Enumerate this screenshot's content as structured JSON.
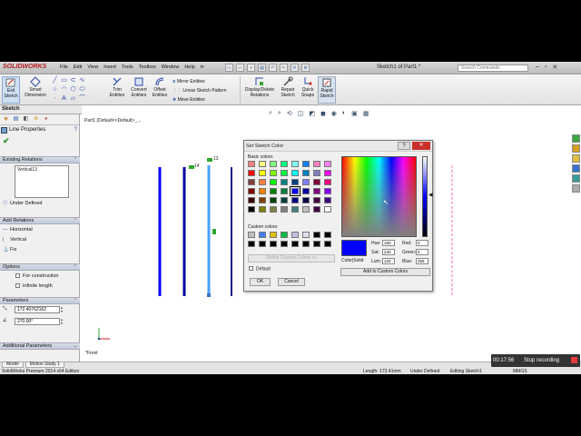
{
  "app": {
    "logo": "SOLIDWORKS",
    "menu": [
      "File",
      "Edit",
      "View",
      "Insert",
      "Tools",
      "Toolbox",
      "Window",
      "Help"
    ],
    "pin": "⊳",
    "document_title": "Sketch1 of Part1 *",
    "search_placeholder": "Search Commands",
    "win_min": "–",
    "win_restore": "▫",
    "win_close": "✕",
    "qat_icons": [
      "new-icon",
      "open-icon",
      "save-icon",
      "print-icon",
      "undo-icon",
      "select-icon",
      "rebuild-icon",
      "options-icon"
    ]
  },
  "command_manager": {
    "exit_sketch": "Exit Sketch",
    "smart_dimension": "Smart Dimension",
    "trim_entities": "Trim Entities",
    "convert_entities": "Convert Entities",
    "offset_entities": "Offset Entities",
    "mirror_entities": "Mirror Entities",
    "linear_sketch_pattern": "Linear Sketch Pattern",
    "move_entities": "Move Entities",
    "display_delete_relations": "Display/Delete Relations",
    "repair_sketch": "Repair Sketch",
    "quick_snaps": "Quick Snaps",
    "rapid_sketch": "Rapid Sketch",
    "tab_label": "Sketch"
  },
  "property_manager": {
    "title": "Line Properties",
    "help": "?",
    "ok": "✔",
    "existing_relations": {
      "header": "Existing Relations",
      "items": [
        "Vertical13"
      ],
      "status": "Under Defined"
    },
    "add_relations": {
      "header": "Add Relations",
      "items": [
        "Horizontal",
        "Vertical",
        "Fix"
      ]
    },
    "options": {
      "header": "Options",
      "for_construction": "For construction",
      "infinite_length": "Infinite length"
    },
    "parameters": {
      "header": "Parameters",
      "length": "172.40762162",
      "angle": "270.00°"
    },
    "additional_parameters": {
      "header": "Additional Parameters"
    }
  },
  "graphics": {
    "tree_label": "Part1  (Default<<Default>_...",
    "front_label": "*Front",
    "relation_tags": [
      "14",
      "13"
    ],
    "line_colors": [
      "#0000ff",
      "#0000a0",
      "#4aa0ff",
      "#1a1a8a"
    ]
  },
  "color_dialog": {
    "title": "Set Sketch Color",
    "help": "?",
    "close": "✕",
    "basic_colors_label": "Basic colors:",
    "custom_colors_label": "Custom colors:",
    "basic_colors": [
      "#ff8080",
      "#ffff80",
      "#80ff80",
      "#00ff80",
      "#80ffff",
      "#0080ff",
      "#ff80c0",
      "#ff80ff",
      "#ff0000",
      "#ffff00",
      "#80ff00",
      "#00ff40",
      "#00ffff",
      "#0080c0",
      "#8080c0",
      "#ff00ff",
      "#804040",
      "#ff8040",
      "#00ff00",
      "#008080",
      "#004080",
      "#8080ff",
      "#800040",
      "#ff0080",
      "#800000",
      "#ff8000",
      "#008000",
      "#008040",
      "#0000ff",
      "#0000a0",
      "#800080",
      "#8000ff",
      "#400000",
      "#804000",
      "#004000",
      "#004040",
      "#000080",
      "#000040",
      "#400040",
      "#400080",
      "#000000",
      "#808000",
      "#808040",
      "#808080",
      "#408080",
      "#c0c0c0",
      "#400040",
      "#ffffff"
    ],
    "custom_colors": [
      "#c0c0c0",
      "#4080ff",
      "#e0c000",
      "#00c040",
      "#c0c0e0",
      "#e0e0f0",
      "#000000",
      "#000000",
      "#000000",
      "#000000",
      "#000000",
      "#000000",
      "#000000",
      "#000000",
      "#000000",
      "#000000"
    ],
    "define_custom": "Define Custom Colors >>",
    "default_label": "Default",
    "ok": "OK",
    "cancel": "Cancel",
    "color_solid_label": "Color|Solid",
    "add_to_custom": "Add to Custom Colors",
    "hue_label": "Hue:",
    "hue": "160",
    "sat_label": "Sat:",
    "sat": "240",
    "lum_label": "Lum:",
    "lum": "120",
    "red_label": "Red:",
    "red": "0",
    "green_label": "Green:",
    "green": "0",
    "blue_label": "Blue:",
    "blue": "255",
    "selected_color": "#0000ff"
  },
  "status_bar": {
    "tabs": [
      "Model",
      "Motion Study 1"
    ],
    "edition": "SolidWorks Premium 2014 x64 Edition",
    "length": "Length: 172.41mm",
    "defined": "Under Defined",
    "editing": "Editing Sketch1",
    "units": "MMGS"
  },
  "recording": {
    "time": "00:17:56",
    "label": "Stop recording"
  }
}
